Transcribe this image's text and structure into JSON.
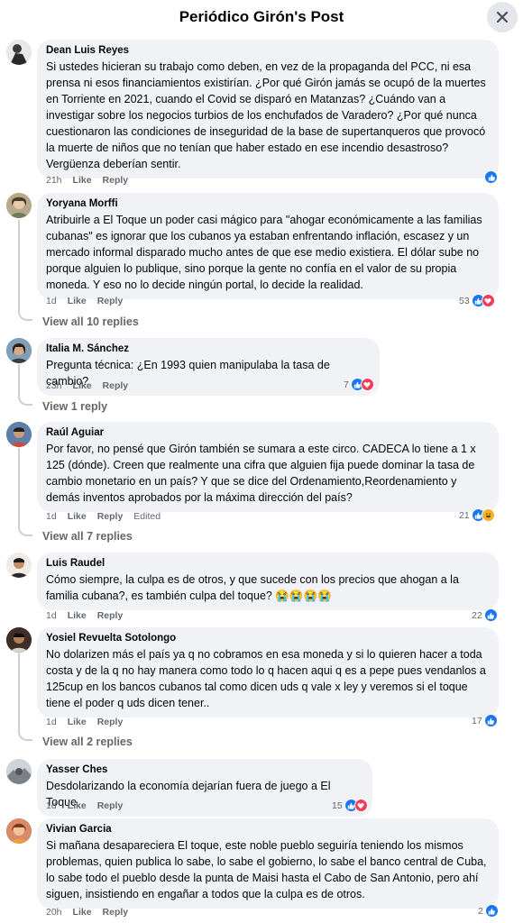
{
  "header": {
    "title": "Periódico Girón's Post"
  },
  "comments": [
    {
      "author": "Dean Luis Reyes",
      "text": "Si ustedes hicieran su trabajo como deben, en vez de la propaganda del PCC, ni esa prensa ni esos financiamientos existirían. ¿Por qué Girón jamás se ocupó de la muertes en Torriente en 2021, cuando el Covid se disparó en Matanzas? ¿Cuándo van a investigar sobre los negocios turbios de los enchufados de Varadero? ¿Por qué nunca cuestionaron las condiciones de inseguridad de la base de supertanqueros que provocó la muerte de niños que no tenían que haber estado en ese incendio desastroso? Vergüenza deberían sentir.",
      "time": "21h",
      "like": "Like",
      "reply": "Reply",
      "count": "",
      "reactions": [
        "like-icon"
      ]
    },
    {
      "author": "Yoryana Morffi",
      "text": "Atribuirle a El Toque un poder casi mágico para \"ahogar económicamente a las familias cubanas\" es ignorar que los cubanos ya estaban enfrentando inflación, escasez y un mercado informal disparado mucho antes de que ese medio existiera. El dólar sube no porque alguien lo publique, sino porque la gente no confía en el valor de su propia moneda. Y eso no lo decide ningún portal, lo decide la realidad.",
      "time": "1d",
      "like": "Like",
      "reply": "Reply",
      "count": "53",
      "reactions": [
        "like-icon",
        "love-icon"
      ],
      "view_replies": "View all 10 replies"
    },
    {
      "author": "Italia M. Sánchez",
      "text": "Pregunta técnica: ¿En 1993 quien manipulaba la tasa de cambio?",
      "time": "23h",
      "like": "Like",
      "reply": "Reply",
      "count": "7",
      "reactions": [
        "like-icon",
        "love-icon"
      ],
      "view_replies": "View 1 reply"
    },
    {
      "author": "Raúl Aguiar",
      "text": "Por favor, no pensé que Girón también se sumara a este circo. CADECA lo tiene a 1 x 125 (dónde). Creen que realmente una cifra que alguien fija puede dominar la tasa de cambio monetario en un país? Y que se dice del Ordenamiento,Reordenamiento y demás inventos aprobados por la máxima dirección del país?",
      "time": "1d",
      "like": "Like",
      "reply": "Reply",
      "edited": "Edited",
      "count": "21",
      "reactions": [
        "like-icon",
        "haha-icon"
      ],
      "view_replies": "View all 7 replies"
    },
    {
      "author": "Luis Raudel",
      "text": "Cómo siempre, la culpa es de otros, y que sucede con los precios que ahogan a la familia cubana?, es también culpa del toque? 😭😭😭😭",
      "time": "1d",
      "like": "Like",
      "reply": "Reply",
      "count": "22",
      "reactions": [
        "like-icon"
      ]
    },
    {
      "author": "Yosiel Revuelta Sotolongo",
      "text": "No dolarizen más el país ya q no cobramos en esa moneda y si lo quieren hacer a toda costa y de la q no hay manera como todo lo q hacen aqui q es a pepe pues vendanlos a 125cup en los bancos cubanos tal como dicen uds q vale x ley y veremos si el toque tiene el poder q uds dicen tener..",
      "time": "1d",
      "like": "Like",
      "reply": "Reply",
      "count": "17",
      "reactions": [
        "like-icon"
      ],
      "view_replies": "View all 2 replies"
    },
    {
      "author": "Yasser Ches",
      "text": "Desdolarizando la economía dejarían fuera de juego a El Toque",
      "time": "1d",
      "like": "Like",
      "reply": "Reply",
      "count": "15",
      "reactions": [
        "like-icon",
        "love-icon"
      ]
    },
    {
      "author": "Vivian Garcia",
      "text": "Si mañana desapareciera El toque, este noble pueblo seguiría teniendo los mismos problemas, quien publica lo sabe, lo sabe el gobierno, lo sabe el banco central de Cuba, lo sabe todo el pueblo desde la punta de Maisi hasta el Cabo de San Antonio, pero ahí siguen, insistiendo en engañar a todos que la culpa es de otros.",
      "time": "20h",
      "like": "Like",
      "reply": "Reply",
      "count": "2",
      "reactions": [
        "like-icon"
      ]
    }
  ],
  "colors": {
    "like": "#1877f2",
    "love": "#f33e58",
    "haha": "#f7b125",
    "bubble": "#f0f2f5",
    "meta": "#65676b"
  }
}
